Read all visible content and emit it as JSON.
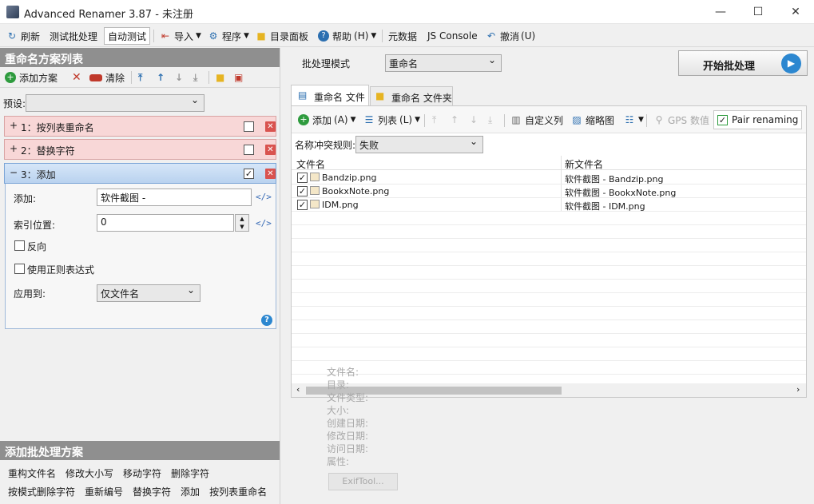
{
  "window": {
    "title": "Advanced Renamer 3.87 - 未注册",
    "minimize": "—",
    "maximize": "☐",
    "close": "✕"
  },
  "toolbar": {
    "refresh": "刷新",
    "test_batch": "测试批处理",
    "auto_test": "自动测试",
    "import": "导入",
    "program": "程序",
    "dir_panel": "目录面板",
    "help": "帮助",
    "help_key": "(H)",
    "metadata": "元数据",
    "js_console": "JS Console",
    "undo": "撤消",
    "undo_key": "(U)"
  },
  "left": {
    "header": "重命名方案列表",
    "add_method": "添加方案",
    "clear": "清除",
    "preset_label": "预设:",
    "preset_value": "",
    "methods": [
      {
        "toggle": "+",
        "label": "1：按列表重命名",
        "checked": false
      },
      {
        "toggle": "+",
        "label": "2：替换字符",
        "checked": false
      },
      {
        "toggle": "−",
        "label": "3：添加",
        "checked": true
      }
    ],
    "detail": {
      "add_label": "添加:",
      "add_value": "软件截图 -",
      "index_label": "索引位置:",
      "index_value": "0",
      "reverse_label": "反向",
      "regex_label": "使用正则表达式",
      "apply_label": "应用到:",
      "apply_value": "仅文件名",
      "code": "</>",
      "help": "?"
    },
    "add_header": "添加批处理方案",
    "add_items": [
      [
        "重构文件名",
        "修改大小写",
        "移动字符",
        "删除字符"
      ],
      [
        "按模式删除字符",
        "重新编号",
        "替换字符",
        "添加",
        "按列表重命名"
      ]
    ]
  },
  "right": {
    "batch_mode_label": "批处理模式",
    "batch_mode_value": "重命名",
    "start_button": "开始批处理",
    "tabs": [
      "重命名 文件",
      "重命名 文件夹"
    ],
    "tools": {
      "add": "添加",
      "add_key": "(A)",
      "list": "列表",
      "list_key": "(L)",
      "custom_cols": "自定义列",
      "thumbnails": "缩略图",
      "gps": "GPS 数值",
      "pair": "Pair renaming"
    },
    "conflict_label": "名称冲突规则:",
    "conflict_value": "失败",
    "col_name": "文件名",
    "col_new": "新文件名",
    "files": [
      {
        "name": "Bandzip.png",
        "new": "软件截图 - Bandzip.png"
      },
      {
        "name": "BookxNote.png",
        "new": "软件截图 - BookxNote.png"
      },
      {
        "name": "IDM.png",
        "new": "软件截图 - IDM.png"
      }
    ],
    "info": [
      "文件名:",
      "目录:",
      "文件类型:",
      "大小:",
      "创建日期:",
      "修改日期:",
      "访问日期:",
      "属性:"
    ],
    "exif_button": "ExifTool..."
  },
  "colors": {
    "accent": "#2c87d0",
    "panel_header": "#8f8f8f",
    "method_unsel": "#f8d7d7",
    "method_sel": "#c3d9f2",
    "red": "#d9534f"
  }
}
